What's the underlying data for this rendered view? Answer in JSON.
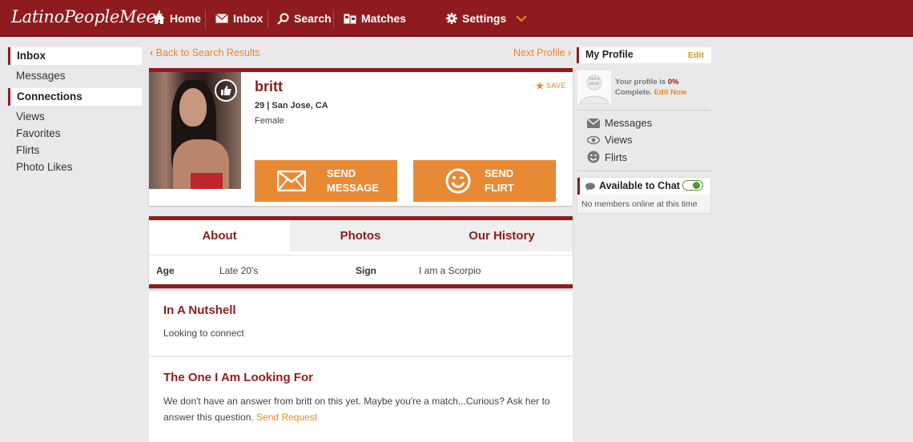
{
  "header": {
    "logo": "LatinoPeopleMeet",
    "nav": [
      {
        "label": "Home",
        "icon": "home-icon"
      },
      {
        "label": "Inbox",
        "icon": "envelope-icon"
      },
      {
        "label": "Search",
        "icon": "search-icon"
      },
      {
        "label": "Matches",
        "icon": "matches-icon"
      },
      {
        "label": "Settings",
        "icon": "gear-icon"
      }
    ]
  },
  "sidebar": {
    "sections": [
      {
        "title": "Inbox",
        "items": [
          "Messages"
        ]
      },
      {
        "title": "Connections",
        "items": [
          "Views",
          "Favorites",
          "Flirts",
          "Photo Likes"
        ]
      }
    ]
  },
  "nav_links": {
    "back": "Back to Search Results",
    "next": "Next Profile"
  },
  "profile": {
    "name": "britt",
    "age_location": "29 | San Jose, CA",
    "gender": "Female",
    "save_label": "SAVE",
    "buttons": [
      {
        "line1": "SEND",
        "line2": "MESSAGE",
        "icon": "envelope-icon"
      },
      {
        "line1": "SEND",
        "line2": "FLIRT",
        "icon": "wink-icon"
      }
    ]
  },
  "tabs": [
    "About",
    "Photos",
    "Our History"
  ],
  "attributes": [
    {
      "key": "Age",
      "value": "Late 20's"
    },
    {
      "key": "Sign",
      "value": "I am a Scorpio"
    }
  ],
  "sections": {
    "nutshell": {
      "title": "In A Nutshell",
      "text": "Looking to connect"
    },
    "looking_for": {
      "title": "The One I Am Looking For",
      "text": "We don't have an answer from britt on this yet. Maybe you're a match...Curious? Ask her to answer this question.",
      "link": "Send Request"
    }
  },
  "my_profile": {
    "title": "My Profile",
    "edit": "Edit",
    "avatar_text": "Add a photo",
    "complete_prefix": "Your profile is",
    "complete_percent": "0%",
    "complete_suffix": "Complete.",
    "edit_now": "Edit Now",
    "links": [
      "Messages",
      "Views",
      "Flirts"
    ]
  },
  "chat": {
    "title": "Available to Chat",
    "status": "No members online at this time",
    "enabled": true
  },
  "colors": {
    "brand": "#8e1c1f",
    "accent": "#e88a34",
    "link": "#e08b2e"
  }
}
